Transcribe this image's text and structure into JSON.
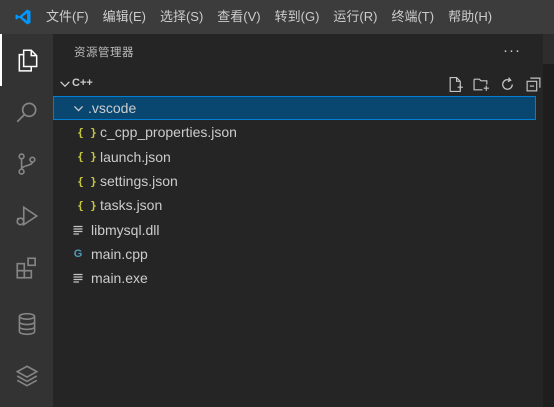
{
  "menu": {
    "items": [
      "文件(F)",
      "编辑(E)",
      "选择(S)",
      "查看(V)",
      "转到(G)",
      "运行(R)",
      "终端(T)",
      "帮助(H)"
    ]
  },
  "activity_bar": {
    "items": [
      {
        "icon": "files-icon",
        "active": true
      },
      {
        "icon": "search-icon",
        "active": false
      },
      {
        "icon": "source-control-icon",
        "active": false
      },
      {
        "icon": "run-debug-icon",
        "active": false
      },
      {
        "icon": "extensions-icon",
        "active": false
      },
      {
        "icon": "database-icon",
        "active": false
      },
      {
        "icon": "layers-icon",
        "active": false
      }
    ]
  },
  "sidebar": {
    "title": "资源管理器",
    "more": "···",
    "section": {
      "title": "C++",
      "actions": [
        "new-file-icon",
        "new-folder-icon",
        "refresh-icon",
        "collapse-all-icon"
      ]
    },
    "tree": [
      {
        "label": ".vscode",
        "type": "folder",
        "depth": 0,
        "selected": true
      },
      {
        "label": "c_cpp_properties.json",
        "type": "json",
        "depth": 1,
        "icon_text": "{ }"
      },
      {
        "label": "launch.json",
        "type": "json",
        "depth": 1,
        "icon_text": "{ }"
      },
      {
        "label": "settings.json",
        "type": "json",
        "depth": 1,
        "icon_text": "{ }"
      },
      {
        "label": "tasks.json",
        "type": "json",
        "depth": 1,
        "icon_text": "{ }"
      },
      {
        "label": "libmysql.dll",
        "type": "file",
        "depth": 0
      },
      {
        "label": "main.cpp",
        "type": "cpp",
        "depth": 0,
        "icon_text": "G"
      },
      {
        "label": "main.exe",
        "type": "file",
        "depth": 0
      }
    ]
  },
  "colors": {
    "accent": "#007acc",
    "selection": "#094771",
    "json_icon": "#cbcb41",
    "cpp_icon": "#519aba"
  }
}
